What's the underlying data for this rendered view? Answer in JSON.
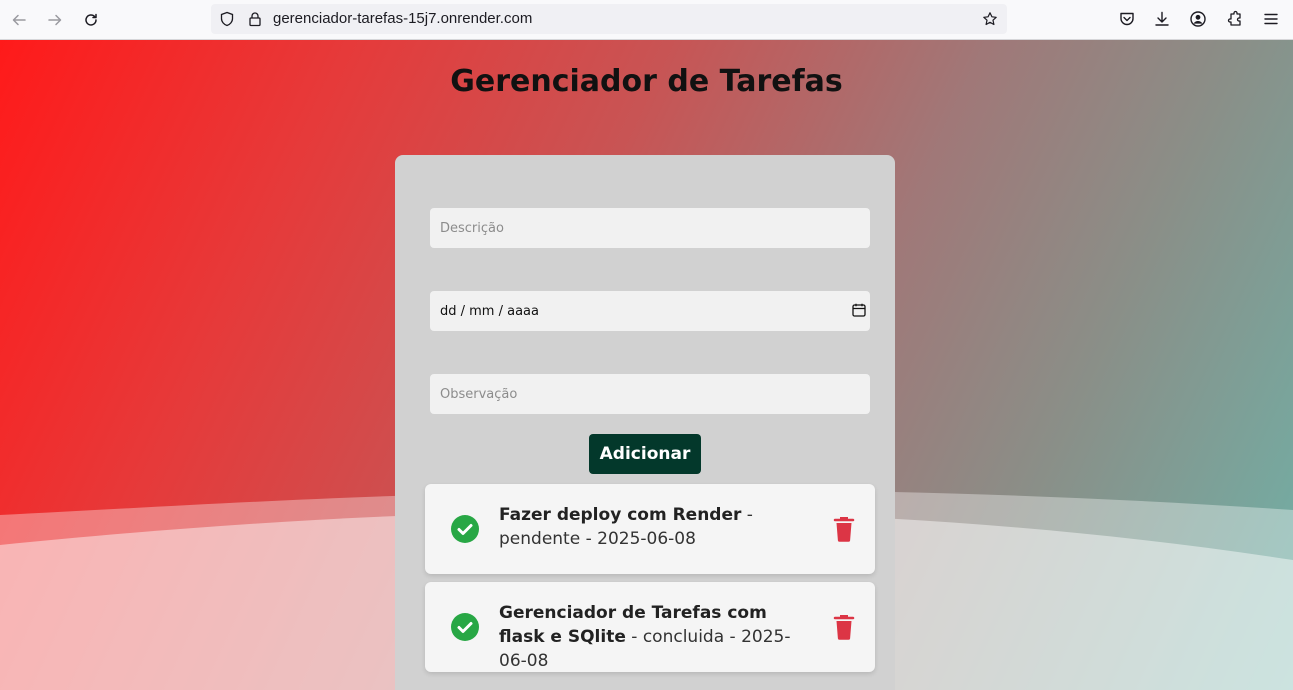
{
  "browser": {
    "url": "gerenciador-tarefas-15j7.onrender.com"
  },
  "page": {
    "title": "Gerenciador de Tarefas"
  },
  "form": {
    "description_placeholder": "Descrição",
    "date_placeholder": "dd / mm / aaaa",
    "observation_placeholder": "Observação",
    "add_label": "Adicionar"
  },
  "tasks": [
    {
      "title": "Fazer deploy com Render",
      "status": "pendente",
      "date": "2025-06-08"
    },
    {
      "title": "Gerenciador de Tarefas com flask e SQlite",
      "status": "concluida",
      "date": "2025-06-08"
    }
  ],
  "separators": {
    "dash": "-"
  },
  "colors": {
    "button_bg": "#03382b",
    "check": "#28a745",
    "trash": "#dc3545",
    "card_bg": "#d1d1d1"
  }
}
